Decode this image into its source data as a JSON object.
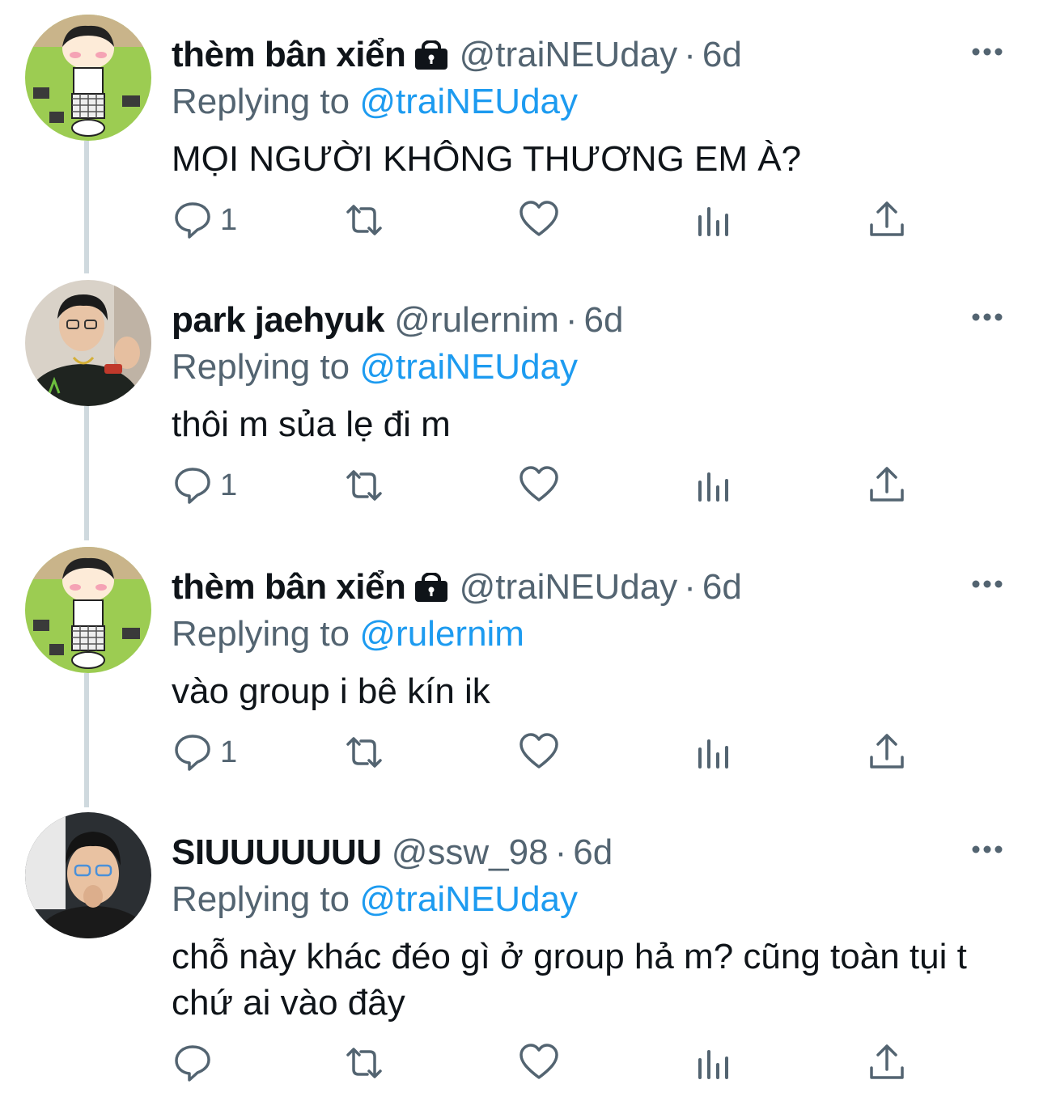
{
  "thread": {
    "tweets": [
      {
        "name": "thèm bân xiển",
        "locked": true,
        "handle": "@traiNEUday",
        "separator": "·",
        "time": "6d",
        "replying_prefix": "Replying to",
        "replying_to": "@traiNEUday",
        "text": "MỌI NGƯỜI KHÔNG THƯƠNG EM À?",
        "reply_count": "1",
        "avatar": "cartoon-avatar"
      },
      {
        "name": "park jaehyuk",
        "locked": false,
        "handle": "@rulernim",
        "separator": "·",
        "time": "6d",
        "replying_prefix": "Replying to",
        "replying_to": "@traiNEUday",
        "text": "thôi m sủa lẹ đi m",
        "reply_count": "1",
        "avatar": "photo-avatar"
      },
      {
        "name": "thèm bân xiển",
        "locked": true,
        "handle": "@traiNEUday",
        "separator": "·",
        "time": "6d",
        "replying_prefix": "Replying to",
        "replying_to": "@rulernim",
        "text": "vào group i bê kín ik",
        "reply_count": "1",
        "avatar": "cartoon-avatar"
      },
      {
        "name": "SIUUUUUUU",
        "locked": false,
        "handle": "@ssw_98",
        "separator": "·",
        "time": "6d",
        "replying_prefix": "Replying to",
        "replying_to": "@traiNEUday",
        "text": "chỗ này khác đéo gì ở group hả m? cũng toàn tụi t chứ ai vào đây",
        "reply_count": "",
        "avatar": "photo-avatar"
      }
    ]
  },
  "icons": {
    "reply": "reply-icon",
    "retweet": "retweet-icon",
    "like": "heart-icon",
    "views": "analytics-icon",
    "share": "share-icon",
    "more": "more-icon",
    "lock": "lock-icon"
  },
  "colors": {
    "text": "#0f1419",
    "secondary": "#536471",
    "accent": "#1d9bf0",
    "thread_line": "#cfd9de"
  }
}
